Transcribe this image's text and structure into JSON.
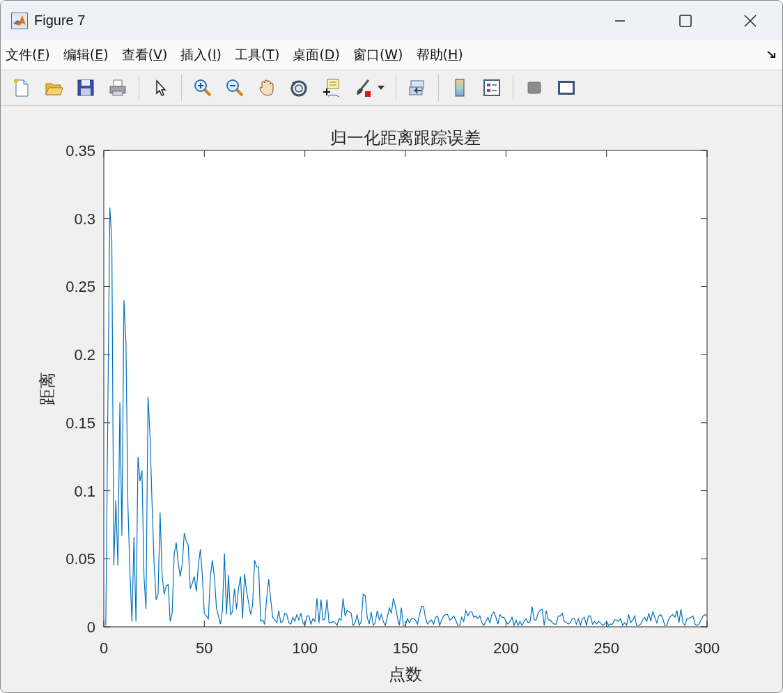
{
  "window": {
    "title": "Figure 7"
  },
  "menu": [
    "文件(F)",
    "编辑(E)",
    "查看(V)",
    "插入(I)",
    "工具(T)",
    "桌面(D)",
    "窗口(W)",
    "帮助(H)"
  ],
  "figure": {
    "chart_data": {
      "type": "line",
      "title": "归一化距离跟踪误差",
      "xlabel": "点数",
      "ylabel": "距离",
      "xlim": [
        0,
        300
      ],
      "ylim": [
        0,
        0.35
      ],
      "xticks": [
        0,
        50,
        100,
        150,
        200,
        250,
        300
      ],
      "yticks": [
        0,
        0.05,
        0.1,
        0.15,
        0.2,
        0.25,
        0.3,
        0.35
      ],
      "x": [
        1,
        2,
        3,
        4,
        5,
        6,
        7,
        8,
        9,
        10,
        11,
        12,
        13,
        14,
        15,
        16,
        17,
        18,
        19,
        20,
        21,
        22,
        23,
        24,
        25,
        26,
        27,
        28,
        29,
        30,
        31,
        32,
        33,
        34,
        35,
        36,
        37,
        38,
        39,
        40,
        41,
        42,
        43,
        44,
        45,
        46,
        47,
        48,
        49,
        50,
        51,
        52,
        53,
        54,
        55,
        56,
        57,
        58,
        59,
        60,
        61,
        62,
        63,
        64,
        65,
        66,
        67,
        68,
        69,
        70,
        71,
        72,
        73,
        74,
        75,
        76,
        77,
        78,
        79,
        80,
        81,
        82,
        83,
        84,
        85,
        86,
        87,
        88,
        89,
        90,
        91,
        92,
        93,
        94,
        95,
        96,
        97,
        98,
        99,
        100,
        101,
        102,
        103,
        104,
        105,
        106,
        107,
        108,
        109,
        110,
        111,
        112,
        113,
        114,
        115,
        116,
        117,
        118,
        119,
        120,
        121,
        122,
        123,
        124,
        125,
        126,
        127,
        128,
        129,
        130,
        131,
        132,
        133,
        134,
        135,
        136,
        137,
        138,
        139,
        140,
        141,
        142,
        143,
        144,
        145,
        146,
        147,
        148,
        149,
        150,
        151,
        152,
        153,
        154,
        155,
        156,
        157,
        158,
        159,
        160,
        161,
        162,
        163,
        164,
        165,
        166,
        167,
        168,
        169,
        170,
        171,
        172,
        173,
        174,
        175,
        176,
        177,
        178,
        179,
        180,
        181,
        182,
        183,
        184,
        185,
        186,
        187,
        188,
        189,
        190,
        191,
        192,
        193,
        194,
        195,
        196,
        197,
        198,
        199,
        200,
        201,
        202,
        203,
        204,
        205,
        206,
        207,
        208,
        209,
        210,
        211,
        212,
        213,
        214,
        215,
        216,
        217,
        218,
        219,
        220,
        221,
        222,
        223,
        224,
        225,
        226,
        227,
        228,
        229,
        230,
        231,
        232,
        233,
        234,
        235,
        236,
        237,
        238,
        239,
        240,
        241,
        242,
        243,
        244,
        245,
        246,
        247,
        248,
        249,
        250,
        251,
        252,
        253,
        254,
        255,
        256,
        257,
        258,
        259,
        260,
        261,
        262,
        263,
        264,
        265,
        266,
        267,
        268,
        269,
        270,
        271,
        272,
        273,
        274,
        275,
        276,
        277,
        278,
        279,
        280,
        281,
        282,
        283,
        284,
        285,
        286,
        287,
        288,
        289,
        290,
        291,
        292,
        293,
        294,
        295,
        296,
        297,
        298,
        299,
        300
      ],
      "series": [
        {
          "color": "#0072bd",
          "values": [
            0.001,
            0.16,
            0.308,
            0.284,
            0.045,
            0.093,
            0.045,
            0.165,
            0.067,
            0.24,
            0.209,
            0.09,
            0.04,
            0.004,
            0.066,
            0.004,
            0.125,
            0.107,
            0.115,
            0.037,
            0.013,
            0.169,
            0.14,
            0.09,
            0.047,
            0.02,
            0.024,
            0.084,
            0.038,
            0.024,
            0.03,
            0.031,
            0.004,
            0.01,
            0.053,
            0.062,
            0.047,
            0.037,
            0.046,
            0.069,
            0.063,
            0.06,
            0.028,
            0.032,
            0.037,
            0.026,
            0.045,
            0.057,
            0.038,
            0.01,
            0.008,
            0.006,
            0.037,
            0.049,
            0.036,
            0.014,
            0.008,
            0.002,
            0.012,
            0.054,
            0.009,
            0.038,
            0.009,
            0.011,
            0.028,
            0.013,
            0.028,
            0.037,
            0.006,
            0.039,
            0.026,
            0.018,
            0.009,
            0.016,
            0.049,
            0.044,
            0.044,
            0.004,
            0.005,
            0.002,
            0.021,
            0.035,
            0.02,
            0.007,
            0.005,
            0.003,
            0.012,
            0.003,
            0.004,
            0.01,
            0.009,
            0.003,
            0.002,
            0.007,
            0.004,
            0.009,
            0.005,
            0.01,
            0.003,
            0.001,
            0.008,
            0.008,
            0.002,
            0.006,
            0.004,
            0.021,
            0.003,
            0.02,
            0.005,
            0.006,
            0.02,
            0.003,
            0.003,
            0.004,
            0.003,
            0.001,
            0.006,
            0.005,
            0.021,
            0.008,
            0.012,
            0.011,
            0.01,
            0.001,
            0.003,
            0.009,
            0.001,
            0.004,
            0.024,
            0.023,
            0.007,
            0.002,
            0.011,
            0.001,
            0.003,
            0.012,
            0.005,
            0.009,
            0.004,
            0.001,
            0.007,
            0.014,
            0.01,
            0.021,
            0.015,
            0.007,
            0.001,
            0.014,
            0.001,
            0.001,
            0.006,
            0.003,
            0.006,
            0.006,
            0.005,
            0.002,
            0.009,
            0.015,
            0.015,
            0.006,
            0.002,
            0.004,
            0.005,
            0.002,
            0.007,
            0.008,
            0.001,
            0.005,
            0.008,
            0.009,
            0.009,
            0.005,
            0.006,
            0.008,
            0.005,
            0.001,
            0.001,
            0.007,
            0.004,
            0.012,
            0.008,
            0.011,
            0.011,
            0.007,
            0.008,
            0.006,
            0.008,
            0.003,
            0.001,
            0.004,
            0.007,
            0.003,
            0.009,
            0.011,
            0.007,
            0.002,
            0.009,
            0.007,
            0.007,
            0.004,
            0.002,
            0.004,
            0.007,
            0.001,
            0.005,
            0.001,
            0.004,
            0.001,
            0.004,
            0.006,
            0.003,
            0.004,
            0.015,
            0.005,
            0.005,
            0.01,
            0.012,
            0.013,
            0.001,
            0.012,
            0.005,
            0.005,
            0.003,
            0.002,
            0.002,
            0.008,
            0.008,
            0.01,
            0.004,
            0.003,
            0.002,
            0.003,
            0.006,
            0.006,
            0.002,
            0.006,
            0.001,
            0.006,
            0.007,
            0.001,
            0.008,
            0.008,
            0.002,
            0.004,
            0.002,
            0.004,
            0.003,
            0.001,
            0.002,
            0.004,
            0.001,
            0.002,
            0.002,
            0.005,
            0.005,
            0.004,
            0.006,
            0.001,
            0.003,
            0.001,
            0.009,
            0.003,
            0.005,
            0.008,
            0.001,
            0.001,
            0.002,
            0.005,
            0.007,
            0.004,
            0.01,
            0.004,
            0.011,
            0.007,
            0.003,
            0.008,
            0.009,
            0.006,
            0.001,
            0.001,
            0.006,
            0.008,
            0.009,
            0.007,
            0.012,
            0.003,
            0.013,
            0.003,
            0.001,
            0.006,
            0.006,
            0.007,
            0.008,
            0.002,
            0.001,
            0.002,
            0.005,
            0.008,
            0.009,
            0.008
          ]
        }
      ]
    }
  }
}
